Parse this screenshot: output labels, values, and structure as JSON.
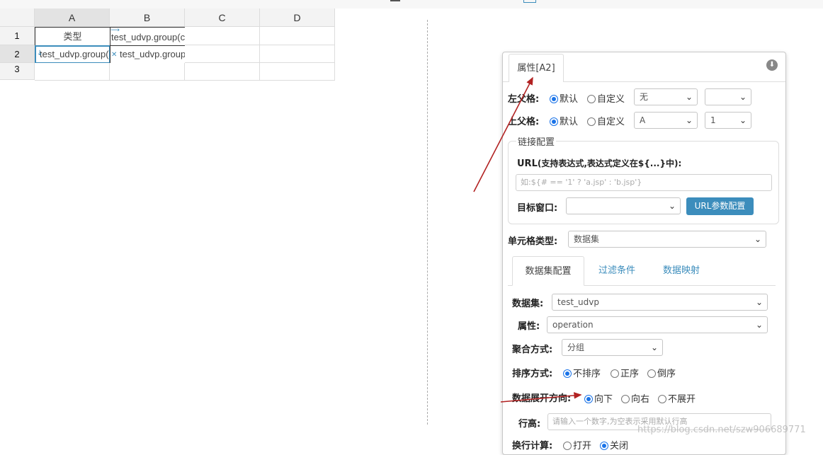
{
  "sheet": {
    "columns": [
      "A",
      "B",
      "C",
      "D"
    ],
    "rows": [
      "1",
      "2",
      "3"
    ],
    "cells": {
      "a1": "类型",
      "b1": "test_udvp.group(c",
      "a2": "test_udvp.group(",
      "b2": "test_udvp.group("
    }
  },
  "panel": {
    "tab_title": "属性[A2]",
    "left_parent": {
      "label": "左父格:",
      "opt_default": "默认",
      "opt_custom": "自定义",
      "select1": "无",
      "select2": ""
    },
    "top_parent": {
      "label": "上父格:",
      "opt_default": "默认",
      "opt_custom": "自定义",
      "select1": "A",
      "select2": "1"
    },
    "link": {
      "legend": "链接配置",
      "url_label": "URL",
      "url_hint": "(支持表达式,表达式定义在${...}中):",
      "url_placeholder": "如:${# == '1' ? 'a.jsp' : 'b.jsp'}",
      "target_label": "目标窗口:",
      "target_value": "",
      "param_button": "URL参数配置"
    },
    "cell_type": {
      "label": "单元格类型:",
      "value": "数据集"
    },
    "tabs": [
      "数据集配置",
      "过滤条件",
      "数据映射"
    ],
    "dataset": {
      "label": "数据集:",
      "value": "test_udvp"
    },
    "attribute": {
      "label": "属性:",
      "value": "operation"
    },
    "aggregate": {
      "label": "聚合方式:",
      "value": "分组"
    },
    "sort": {
      "label": "排序方式:",
      "opt_none": "不排序",
      "opt_asc": "正序",
      "opt_desc": "倒序"
    },
    "expand": {
      "label": "数据展开方向:",
      "opt_down": "向下",
      "opt_right": "向右",
      "opt_none": "不展开"
    },
    "row_height": {
      "label": "行高:",
      "placeholder": "请输入一个数字,为空表示采用默认行高"
    },
    "wrap": {
      "label": "换行计算:",
      "opt_on": "打开",
      "opt_off": "关闭"
    }
  },
  "watermark": "https://blog.csdn.net/szw906689771",
  "colors": {
    "accent": "#3c8dbc",
    "radio": "#1a73e8",
    "arrow": "#b22222"
  }
}
